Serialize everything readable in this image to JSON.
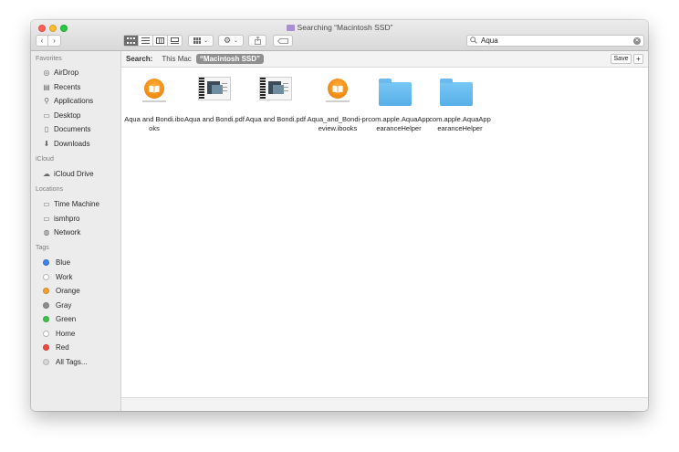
{
  "window": {
    "title": "Searching “Macintosh SSD”"
  },
  "toolbar": {
    "back": "‹",
    "forward": "›",
    "views": [
      "icon-view",
      "list-view",
      "column-view",
      "gallery-view"
    ],
    "group_icon": "grid-icon",
    "action_icon": "gear-icon",
    "share_icon": "share-icon",
    "tag_icon": "tag-icon"
  },
  "search": {
    "value": "Aqua",
    "placeholder": "Search"
  },
  "sidebar": {
    "favorites_header": "Favorites",
    "favorites": [
      {
        "label": "AirDrop",
        "icon": "airdrop-icon"
      },
      {
        "label": "Recents",
        "icon": "recents-icon"
      },
      {
        "label": "Applications",
        "icon": "applications-icon"
      },
      {
        "label": "Desktop",
        "icon": "desktop-icon"
      },
      {
        "label": "Documents",
        "icon": "documents-icon"
      },
      {
        "label": "Downloads",
        "icon": "downloads-icon"
      }
    ],
    "icloud_header": "iCloud",
    "icloud": [
      {
        "label": "iCloud Drive",
        "icon": "cloud-icon"
      }
    ],
    "locations_header": "Locations",
    "locations": [
      {
        "label": "Time Machine",
        "icon": "disk-icon"
      },
      {
        "label": "ismhpro",
        "icon": "computer-icon"
      },
      {
        "label": "Network",
        "icon": "network-icon"
      }
    ],
    "tags_header": "Tags",
    "tags": [
      {
        "label": "Blue",
        "color": "#3b82f6"
      },
      {
        "label": "Work",
        "color": "#ffffff"
      },
      {
        "label": "Orange",
        "color": "#f5a030"
      },
      {
        "label": "Gray",
        "color": "#8e8e8e"
      },
      {
        "label": "Green",
        "color": "#3fc24a"
      },
      {
        "label": "Home",
        "color": "#ffffff"
      },
      {
        "label": "Red",
        "color": "#f04b40"
      },
      {
        "label": "All Tags...",
        "color": "#d6d6d6"
      }
    ]
  },
  "scope": {
    "label": "Search:",
    "this_mac": "This Mac",
    "selected": "“Macintosh SSD”",
    "save": "Save",
    "add": "+"
  },
  "files": [
    {
      "name": "Aqua and Bondi.ibooks",
      "kind": "ibooks"
    },
    {
      "name": "Aqua and Bondi.pdf",
      "kind": "pdf"
    },
    {
      "name": "Aqua and Bondi.pdf",
      "kind": "pdf"
    },
    {
      "name": "Aqua_and_Bondi-preview.ibooks",
      "kind": "ibooks"
    },
    {
      "name": "com.apple.AquaAppearanceHelper",
      "kind": "folder"
    },
    {
      "name": "com.apple.AquaAppearanceHelper",
      "kind": "folder"
    }
  ]
}
